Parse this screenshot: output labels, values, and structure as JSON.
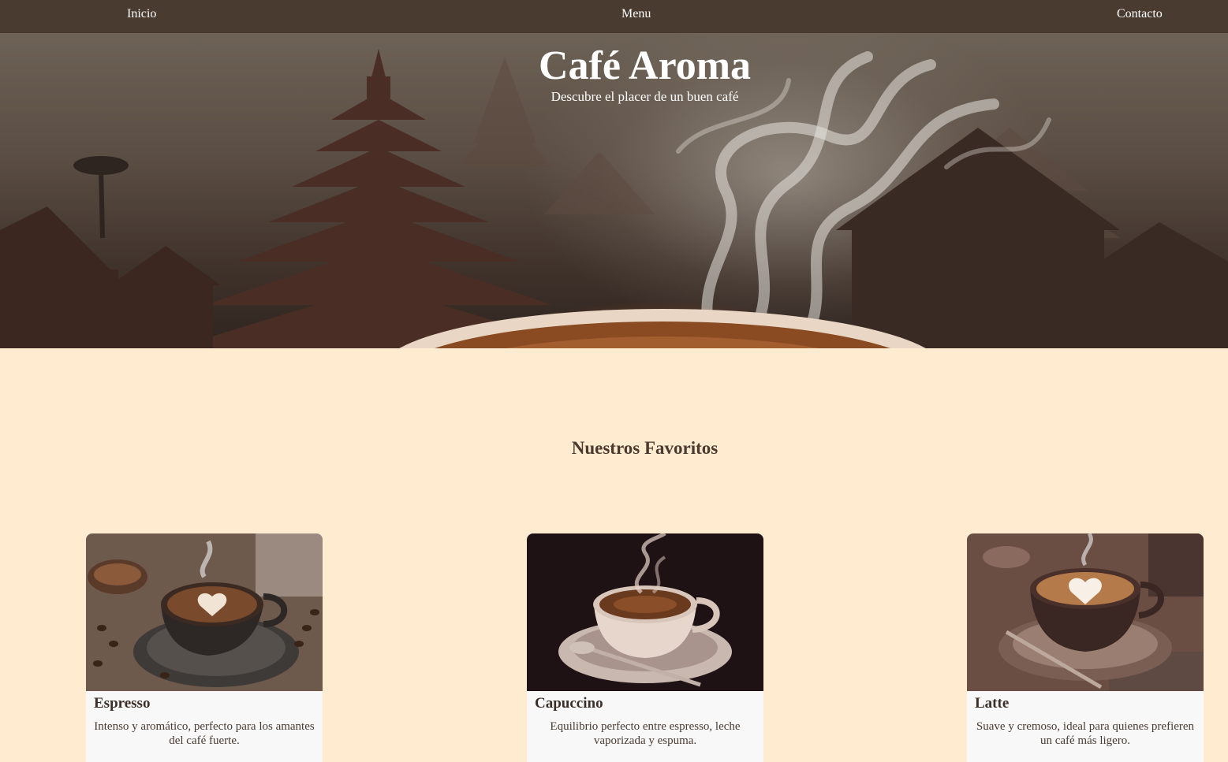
{
  "nav": {
    "items": [
      {
        "label": "Inicio"
      },
      {
        "label": "Menu"
      },
      {
        "label": "Contacto"
      }
    ]
  },
  "hero": {
    "title": "Café Aroma",
    "subtitle": "Descubre el placer de un buen café"
  },
  "favorites": {
    "title": "Nuestros Favoritos",
    "items": [
      {
        "name": "Espresso",
        "description": "Intenso y aromático, perfecto para los amantes del café fuerte."
      },
      {
        "name": "Capuccino",
        "description": "Equilibrio perfecto entre espresso, leche vaporizada y espuma."
      },
      {
        "name": "Latte",
        "description": "Suave y cremoso, ideal para quienes prefieren un café más ligero."
      }
    ]
  },
  "colors": {
    "nav_bg": "#4a3b31",
    "page_bg": "#ffebd0",
    "card_bg": "#f8f8f8",
    "text_dark": "#4a3b31"
  }
}
